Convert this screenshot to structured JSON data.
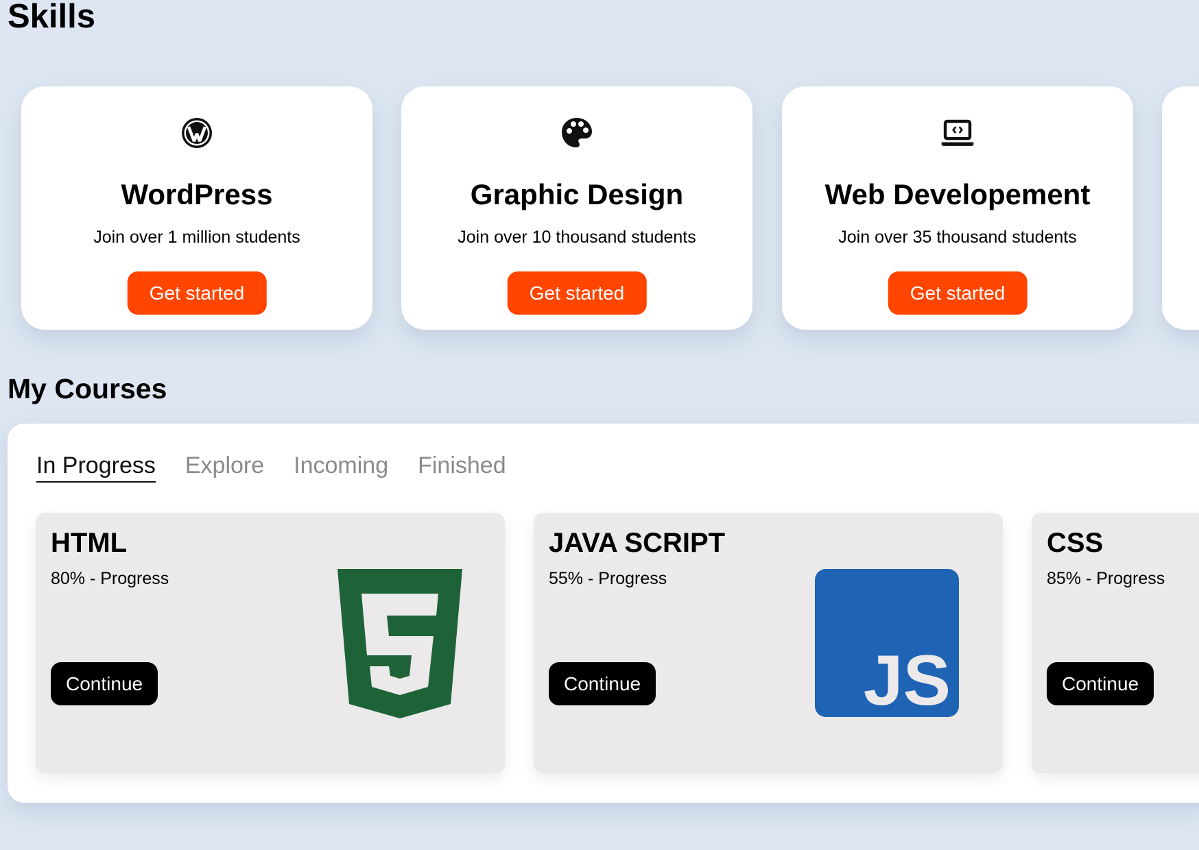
{
  "skills": {
    "title": "Skills",
    "cards": [
      {
        "name": "WordPress",
        "subtitle": "Join over 1 million students",
        "button": "Get started",
        "icon": "wordpress-icon"
      },
      {
        "name": "Graphic Design",
        "subtitle": "Join over 10 thousand students",
        "button": "Get started",
        "icon": "palette-icon"
      },
      {
        "name": "Web Developement",
        "subtitle": "Join over 35 thousand students",
        "button": "Get started",
        "icon": "laptop-code-icon"
      }
    ]
  },
  "courses": {
    "title": "My Courses",
    "tabs": [
      "In Progress",
      "Explore",
      "Incoming",
      "Finished"
    ],
    "active_tab": "In Progress",
    "cards": [
      {
        "name": "HTML",
        "progress": "80% - Progress",
        "progress_value": 80,
        "button": "Continue",
        "logo": "html5-logo",
        "logo_color": "#1e6338"
      },
      {
        "name": "JAVA SCRIPT",
        "progress": "55% - Progress",
        "progress_value": 55,
        "button": "Continue",
        "logo": "javascript-logo",
        "logo_color": "#1e63b4"
      },
      {
        "name": "CSS",
        "progress": "85% - Progress",
        "progress_value": 85,
        "button": "Continue",
        "logo": "css3-logo"
      }
    ]
  },
  "colors": {
    "background": "#dde6f2",
    "accent": "#ff4500",
    "course_card": "#ebe9ea",
    "continue_button": "#000000"
  }
}
